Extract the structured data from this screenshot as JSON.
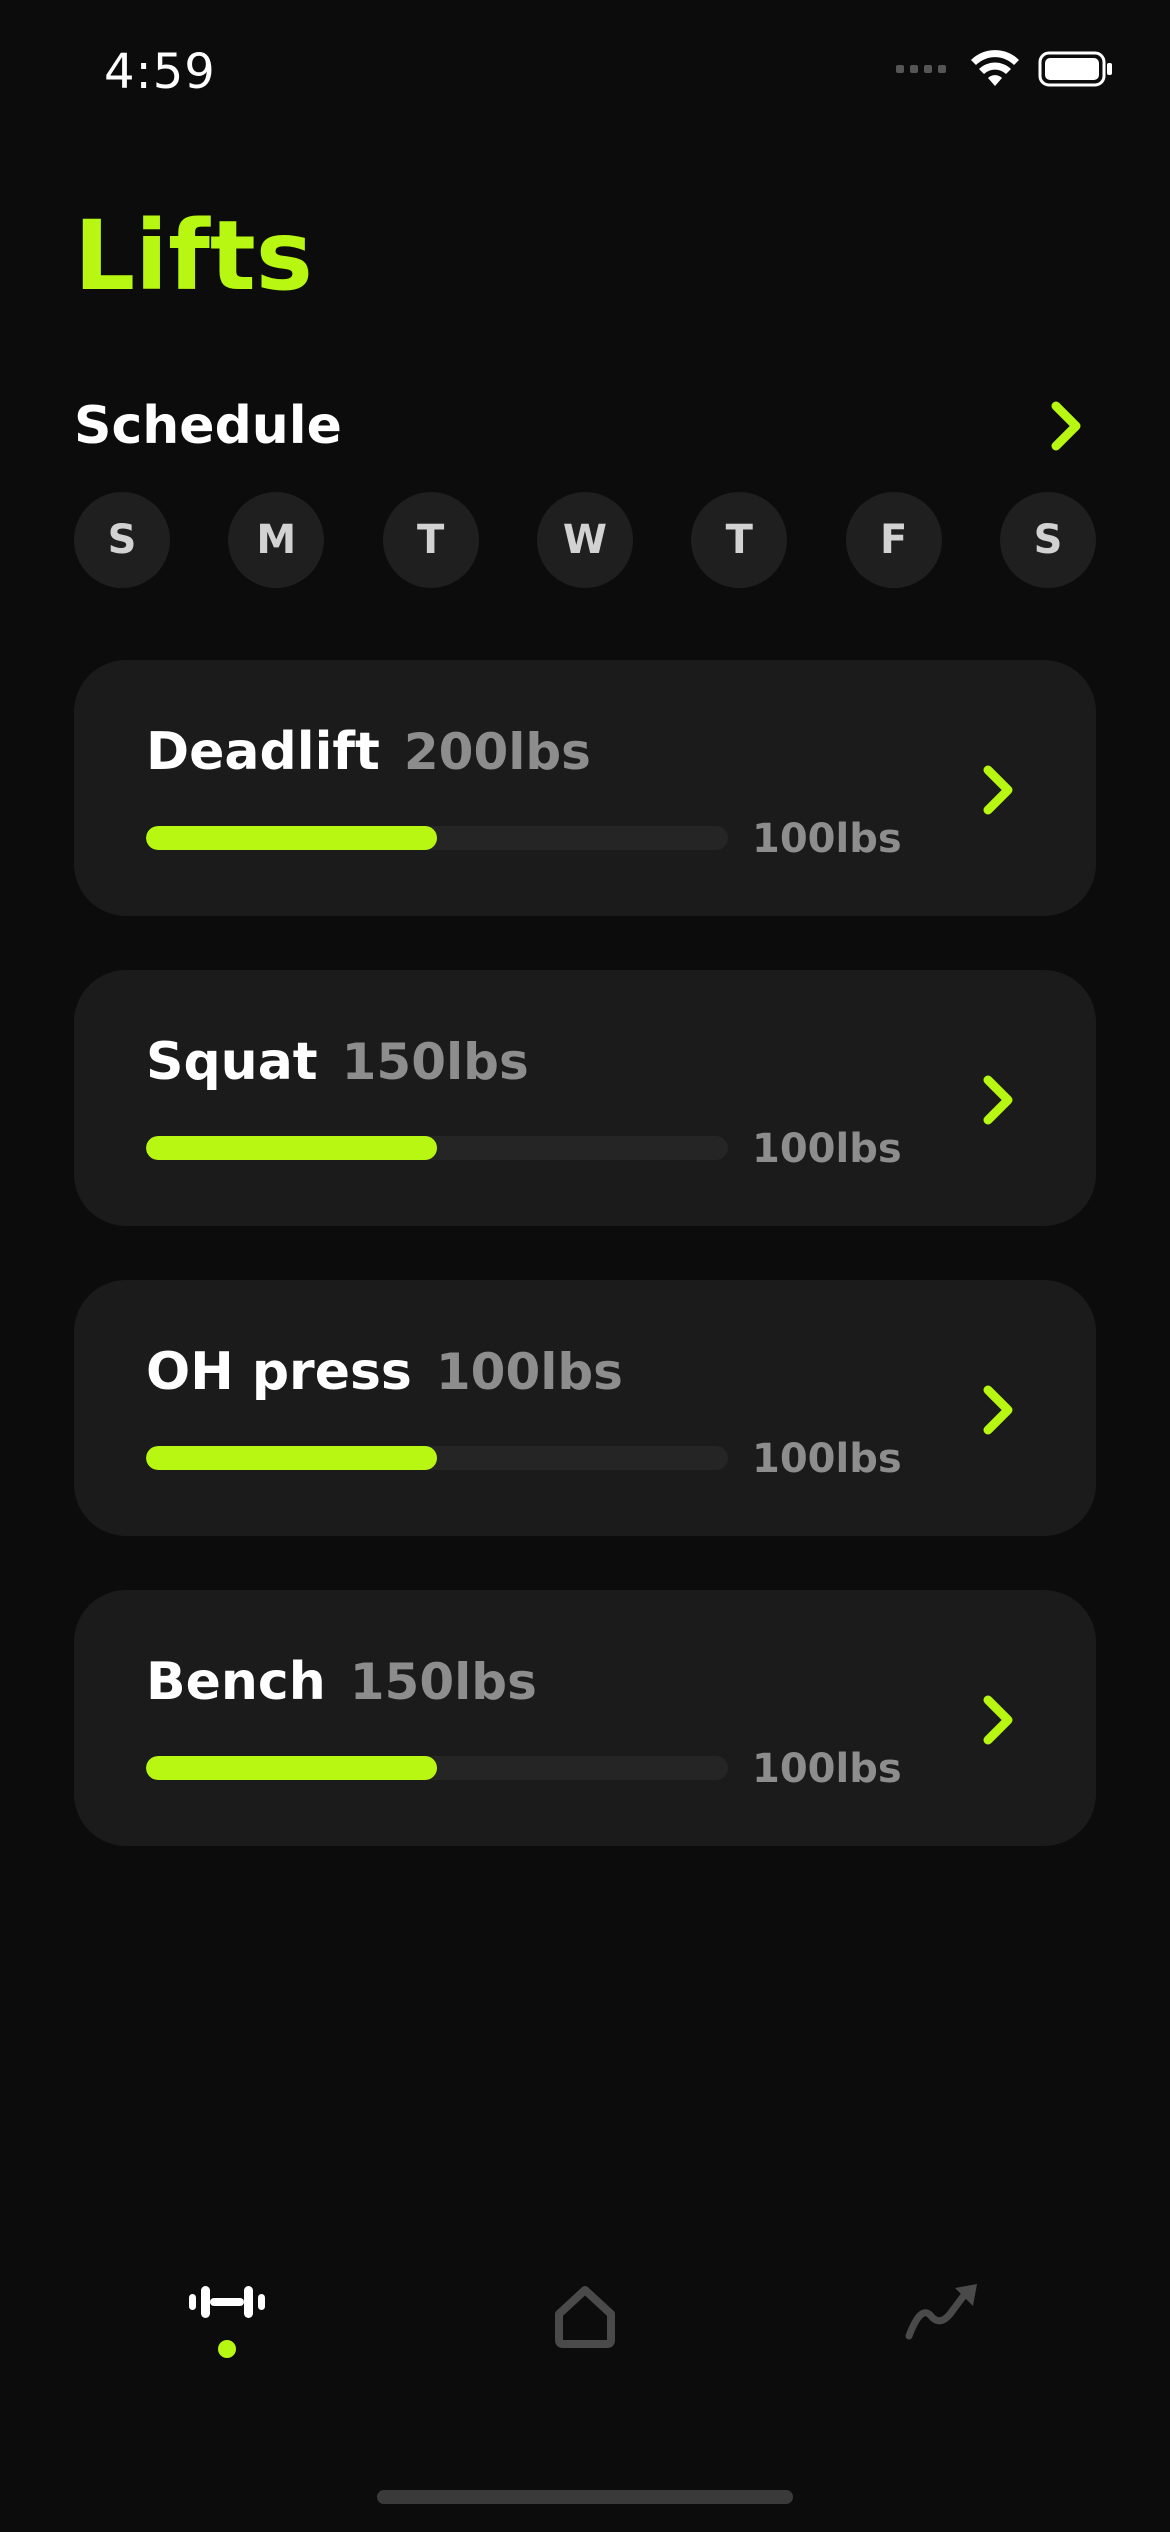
{
  "status_bar": {
    "time": "4:59",
    "icons": [
      "cellular-signal-icon",
      "wifi-icon",
      "battery-icon"
    ]
  },
  "page": {
    "title": "Lifts"
  },
  "schedule": {
    "label": "Schedule",
    "chevron_icon": "chevron-right-icon",
    "days": [
      "S",
      "M",
      "T",
      "W",
      "T",
      "F",
      "S"
    ]
  },
  "lifts": [
    {
      "name": "Deadlift",
      "target": "200lbs",
      "current": "100lbs",
      "progress": 0.5
    },
    {
      "name": "Squat",
      "target": "150lbs",
      "current": "100lbs",
      "progress": 0.5
    },
    {
      "name": "OH press",
      "target": "100lbs",
      "current": "100lbs",
      "progress": 0.5
    },
    {
      "name": "Bench",
      "target": "150lbs",
      "current": "100lbs",
      "progress": 0.5
    }
  ],
  "tab_bar": {
    "tabs": [
      {
        "icon": "dumbbell-icon",
        "active": true
      },
      {
        "icon": "home-icon",
        "active": false
      },
      {
        "icon": "trend-arrow-icon",
        "active": false
      }
    ]
  },
  "colors": {
    "accent": "#b7f711",
    "background": "#0c0c0c",
    "card": "#1b1b1b",
    "muted_text": "#8d8d8d",
    "inactive_icon": "#4a4a4a"
  }
}
